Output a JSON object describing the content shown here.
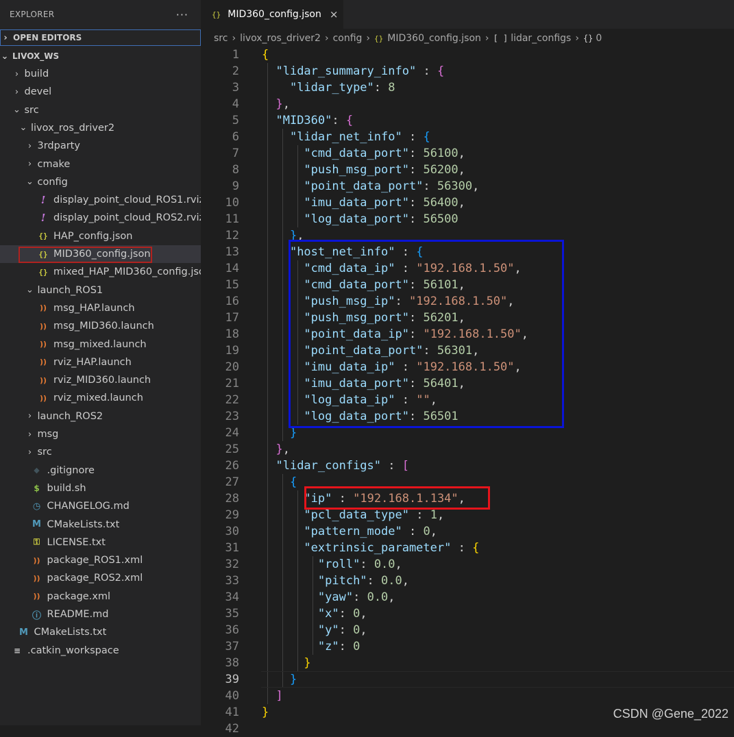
{
  "sidebar": {
    "title": "EXPLORER",
    "more": "···",
    "open_editors": "OPEN EDITORS",
    "workspace": "LIVOX_WS",
    "items": [
      {
        "label": "build",
        "chev": "›",
        "icon": "",
        "name": "folder-build"
      },
      {
        "label": "devel",
        "chev": "›",
        "icon": "",
        "name": "folder-devel"
      },
      {
        "label": "src",
        "chev": "⌄",
        "icon": "",
        "name": "folder-src"
      },
      {
        "label": "livox_ros_driver2",
        "chev": "⌄",
        "icon": "",
        "name": "folder-livox-ros-driver2"
      },
      {
        "label": "3rdparty",
        "chev": "›",
        "icon": "",
        "name": "folder-3rdparty"
      },
      {
        "label": "cmake",
        "chev": "›",
        "icon": "",
        "name": "folder-cmake"
      },
      {
        "label": "config",
        "chev": "⌄",
        "icon": "",
        "name": "folder-config"
      },
      {
        "label": "display_point_cloud_ROS1.rviz",
        "chev": "",
        "icon": "!",
        "name": "file-display-point-cloud-ros1"
      },
      {
        "label": "display_point_cloud_ROS2.rviz",
        "chev": "",
        "icon": "!",
        "name": "file-display-point-cloud-ros2"
      },
      {
        "label": "HAP_config.json",
        "chev": "",
        "icon": "{}",
        "name": "file-hap-config"
      },
      {
        "label": "MID360_config.json",
        "chev": "",
        "icon": "{}",
        "name": "file-mid360-config"
      },
      {
        "label": "mixed_HAP_MID360_config.json",
        "chev": "",
        "icon": "{}",
        "name": "file-mixed-hap-mid360-config"
      },
      {
        "label": "launch_ROS1",
        "chev": "⌄",
        "icon": "",
        "name": "folder-launch-ros1"
      },
      {
        "label": "msg_HAP.launch",
        "chev": "",
        "icon": "ⷯ",
        "name": "file-msg-hap-launch"
      },
      {
        "label": "msg_MID360.launch",
        "chev": "",
        "icon": "ⷯ",
        "name": "file-msg-mid360-launch"
      },
      {
        "label": "msg_mixed.launch",
        "chev": "",
        "icon": "ⷯ",
        "name": "file-msg-mixed-launch"
      },
      {
        "label": "rviz_HAP.launch",
        "chev": "",
        "icon": "ⷯ",
        "name": "file-rviz-hap-launch"
      },
      {
        "label": "rviz_MID360.launch",
        "chev": "",
        "icon": "ⷯ",
        "name": "file-rviz-mid360-launch"
      },
      {
        "label": "rviz_mixed.launch",
        "chev": "",
        "icon": "ⷯ",
        "name": "file-rviz-mixed-launch"
      },
      {
        "label": "launch_ROS2",
        "chev": "›",
        "icon": "",
        "name": "folder-launch-ros2"
      },
      {
        "label": "msg",
        "chev": "›",
        "icon": "",
        "name": "folder-msg"
      },
      {
        "label": "src",
        "chev": "›",
        "icon": "",
        "name": "folder-src-inner"
      },
      {
        "label": ".gitignore",
        "chev": "",
        "icon": "◆",
        "name": "file-gitignore"
      },
      {
        "label": "build.sh",
        "chev": "",
        "icon": "$",
        "name": "file-build-sh"
      },
      {
        "label": "CHANGELOG.md",
        "chev": "",
        "icon": "◷",
        "name": "file-changelog"
      },
      {
        "label": "CMakeLists.txt",
        "chev": "",
        "icon": "M",
        "name": "file-cmakelists"
      },
      {
        "label": "LICENSE.txt",
        "chev": "",
        "icon": "⚿",
        "name": "file-license"
      },
      {
        "label": "package_ROS1.xml",
        "chev": "",
        "icon": "ⷯ",
        "name": "file-package-ros1"
      },
      {
        "label": "package_ROS2.xml",
        "chev": "",
        "icon": "ⷯ",
        "name": "file-package-ros2"
      },
      {
        "label": "package.xml",
        "chev": "",
        "icon": "ⷯ",
        "name": "file-package-xml"
      },
      {
        "label": "README.md",
        "chev": "",
        "icon": "ⓘ",
        "name": "file-readme"
      },
      {
        "label": "CMakeLists.txt",
        "chev": "",
        "icon": "M",
        "name": "file-cmakelists-root"
      },
      {
        "label": ".catkin_workspace",
        "chev": "",
        "icon": "≡",
        "name": "file-catkin-workspace"
      }
    ],
    "link_arrow": "↳"
  },
  "editor": {
    "tab_label": "MID360_config.json",
    "tab_icon": "{}",
    "tab_close": "×",
    "breadcrumb": {
      "parts": [
        "src",
        "livox_ros_driver2",
        "config",
        "MID360_config.json",
        "lidar_configs",
        "0"
      ],
      "sep": "›",
      "json_icon": "{}",
      "array_icon": "[ ]",
      "object_icon": "{}"
    },
    "current_line": 39,
    "lines": [
      "{",
      "  \"lidar_summary_info\" : {",
      "    \"lidar_type\": 8",
      "  },",
      "  \"MID360\": {",
      "    \"lidar_net_info\" : {",
      "      \"cmd_data_port\": 56100,",
      "      \"push_msg_port\": 56200,",
      "      \"point_data_port\": 56300,",
      "      \"imu_data_port\": 56400,",
      "      \"log_data_port\": 56500",
      "    },",
      "    \"host_net_info\" : {",
      "      \"cmd_data_ip\" : \"192.168.1.50\",",
      "      \"cmd_data_port\": 56101,",
      "      \"push_msg_ip\": \"192.168.1.50\",",
      "      \"push_msg_port\": 56201,",
      "      \"point_data_ip\": \"192.168.1.50\",",
      "      \"point_data_port\": 56301,",
      "      \"imu_data_ip\" : \"192.168.1.50\",",
      "      \"imu_data_port\": 56401,",
      "      \"log_data_ip\" : \"\",",
      "      \"log_data_port\": 56501",
      "    }",
      "  },",
      "  \"lidar_configs\" : [",
      "    {",
      "      \"ip\" : \"192.168.1.134\",",
      "      \"pcl_data_type\" : 1,",
      "      \"pattern_mode\" : 0,",
      "      \"extrinsic_parameter\" : {",
      "        \"roll\": 0.0,",
      "        \"pitch\": 0.0,",
      "        \"yaw\": 0.0,",
      "        \"x\": 0,",
      "        \"y\": 0,",
      "        \"z\": 0",
      "      }",
      "    }",
      "  ]",
      "}",
      ""
    ]
  },
  "watermark": "CSDN @Gene_2022"
}
